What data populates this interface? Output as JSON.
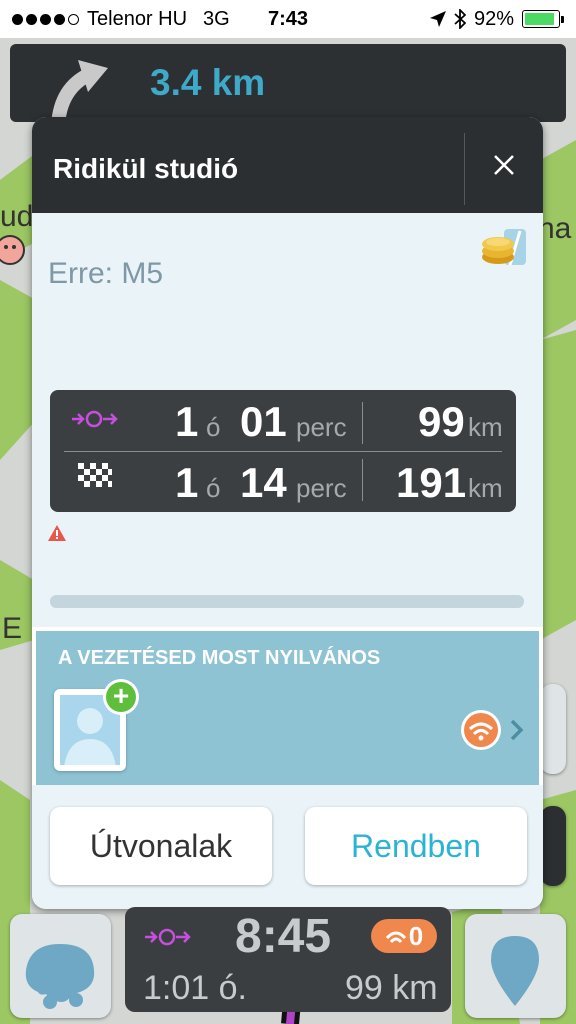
{
  "status_bar": {
    "carrier": "Telenor HU",
    "network": "3G",
    "time": "7:43",
    "battery_percent": "92%",
    "battery_level": 0.92
  },
  "nav_banner": {
    "distance": "3.4 km",
    "icon": "turn-left-arrow-icon"
  },
  "map": {
    "labels": [
      "ud",
      "na",
      "E"
    ]
  },
  "dialog": {
    "title": "Ridikül studió",
    "close_icon": "close-icon",
    "via": "Erre: M5",
    "route_rows": [
      {
        "icon": "waypoint-arrows-icon",
        "hours": "1",
        "h_unit": "ó",
        "minutes": "01",
        "m_unit": "perc",
        "distance": "99",
        "d_unit": "km"
      },
      {
        "icon": "checkered-flag-icon",
        "hours": "1",
        "h_unit": "ó",
        "minutes": "14",
        "m_unit": "perc",
        "distance": "191",
        "d_unit": "km"
      }
    ],
    "warning_icon": "warning-triangle-icon",
    "share": {
      "title": "A VEZETÉSED MOST NYILVÁNOS",
      "avatar_icon": "avatar-placeholder-icon",
      "add_icon": "plus-icon",
      "signal_icon": "broadcast-icon",
      "chevron_icon": "chevron-right-icon"
    },
    "buttons": {
      "routes": "Útvonalak",
      "ok": "Rendben"
    },
    "colors": {
      "header": "#2c2f31",
      "body": "#eaf4f8",
      "share_panel": "#8ec3d3",
      "ok_text": "#2bb3d6"
    }
  },
  "bottom_bar": {
    "eta_time": "8:45",
    "duration": "1:01 ó.",
    "distance": "99 km",
    "traffic_count": "0",
    "left_icon": "waze-menu-icon",
    "right_icon": "report-pin-icon"
  }
}
